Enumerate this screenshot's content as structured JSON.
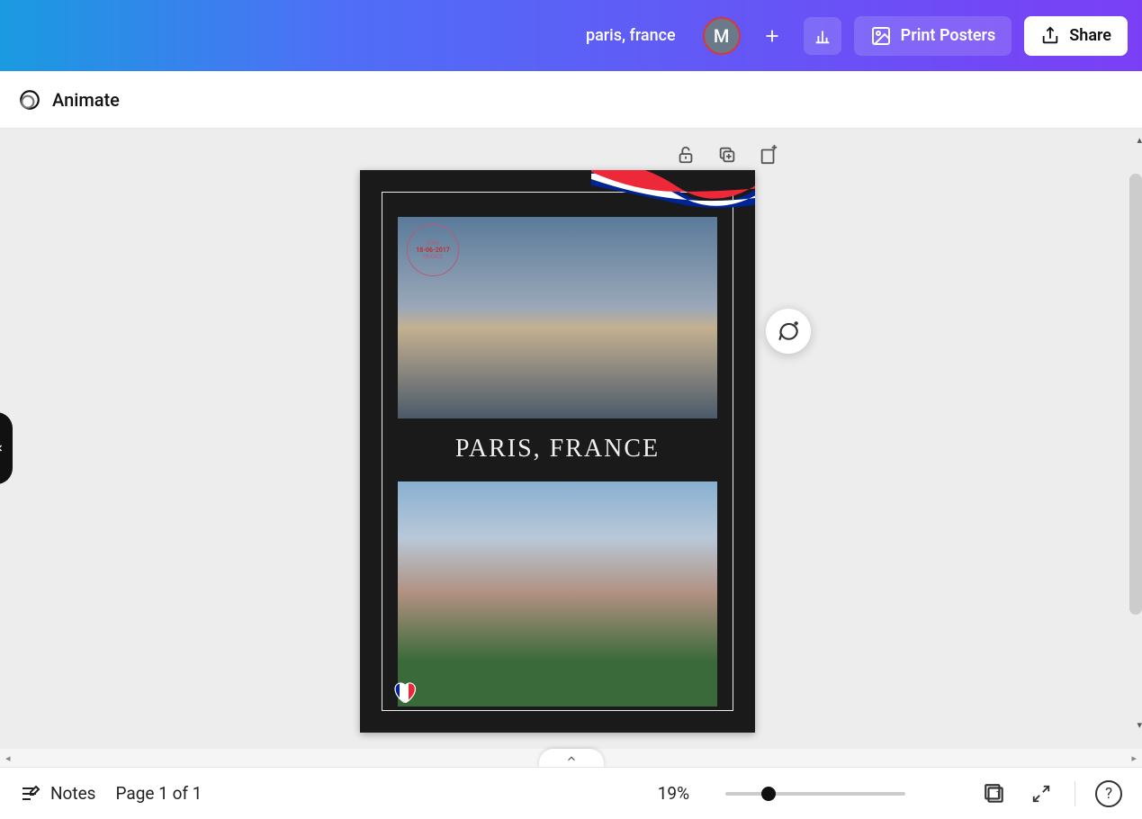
{
  "header": {
    "doc_title": "paris, france",
    "avatar_initial": "M",
    "print_label": "Print Posters",
    "share_label": "Share"
  },
  "toolbar": {
    "animate_label": "Animate"
  },
  "poster": {
    "title": "PARIS, FRANCE",
    "stamp_top": "LYON",
    "stamp_date": "18-06-2017",
    "stamp_bottom": "FRANCE"
  },
  "footer": {
    "notes_label": "Notes",
    "page_indicator": "Page 1 of 1",
    "zoom_pct": "19%",
    "grid_page": "1",
    "help": "?"
  }
}
